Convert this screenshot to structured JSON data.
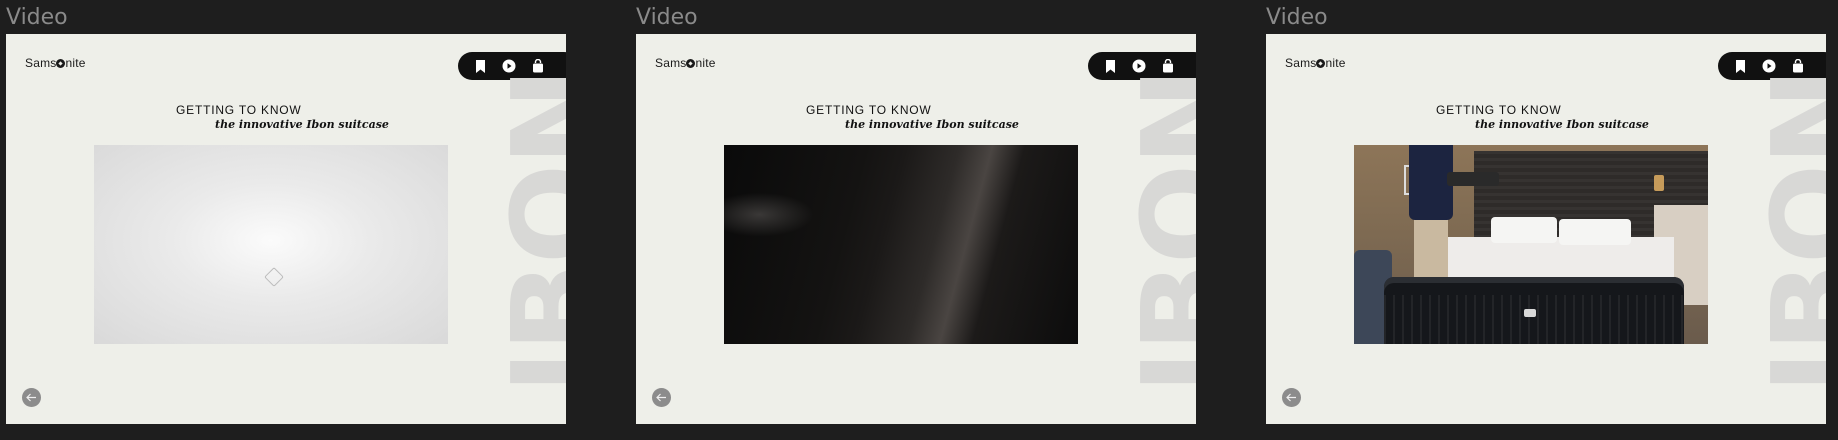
{
  "frames": [
    {
      "label": "Video",
      "logo": "Samsonite",
      "heading_line1": "GETTING TO KNOW",
      "heading_line2": "the innovative Ibon suitcase",
      "vertical_word": "IBON",
      "video_state": "loading"
    },
    {
      "label": "Video",
      "logo": "Samsonite",
      "heading_line1": "GETTING TO KNOW",
      "heading_line2": "the innovative Ibon suitcase",
      "vertical_word": "IBON",
      "video_state": "playing-closeup"
    },
    {
      "label": "Video",
      "logo": "Samsonite",
      "heading_line1": "GETTING TO KNOW",
      "heading_line2": "the innovative Ibon suitcase",
      "vertical_word": "IBON",
      "video_state": "playing-hotel-room"
    }
  ],
  "nav_icons": [
    "bookmark-icon",
    "play-icon",
    "shopping-bag-icon"
  ],
  "back_icon": "arrow-left-icon",
  "colors": {
    "canvas": "#1e1e1e",
    "artboard": "#eeefe9",
    "nav_pill": "#111111",
    "vertical_word": "#d8d8d6",
    "back_button": "#8c8c8c"
  }
}
